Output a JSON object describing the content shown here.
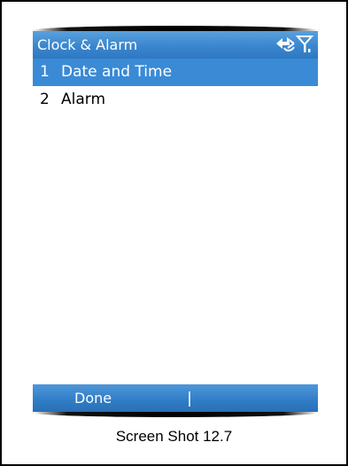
{
  "title_bar": {
    "title": "Clock & Alarm",
    "icons": [
      "connection-arrows-icon",
      "signal-antenna-icon"
    ]
  },
  "menu": {
    "items": [
      {
        "number": "1",
        "label": "Date and Time",
        "selected": true
      },
      {
        "number": "2",
        "label": "Alarm",
        "selected": false
      }
    ]
  },
  "soft_keys": {
    "left_label": "Done",
    "right_label": ""
  },
  "caption": "Screen Shot 12.7",
  "colors": {
    "title_bar": "#3a86cf",
    "selection": "#3a8ad6",
    "soft_key_bar": "#2f7cc6",
    "text_on_blue": "#ffffff",
    "text": "#000000"
  }
}
